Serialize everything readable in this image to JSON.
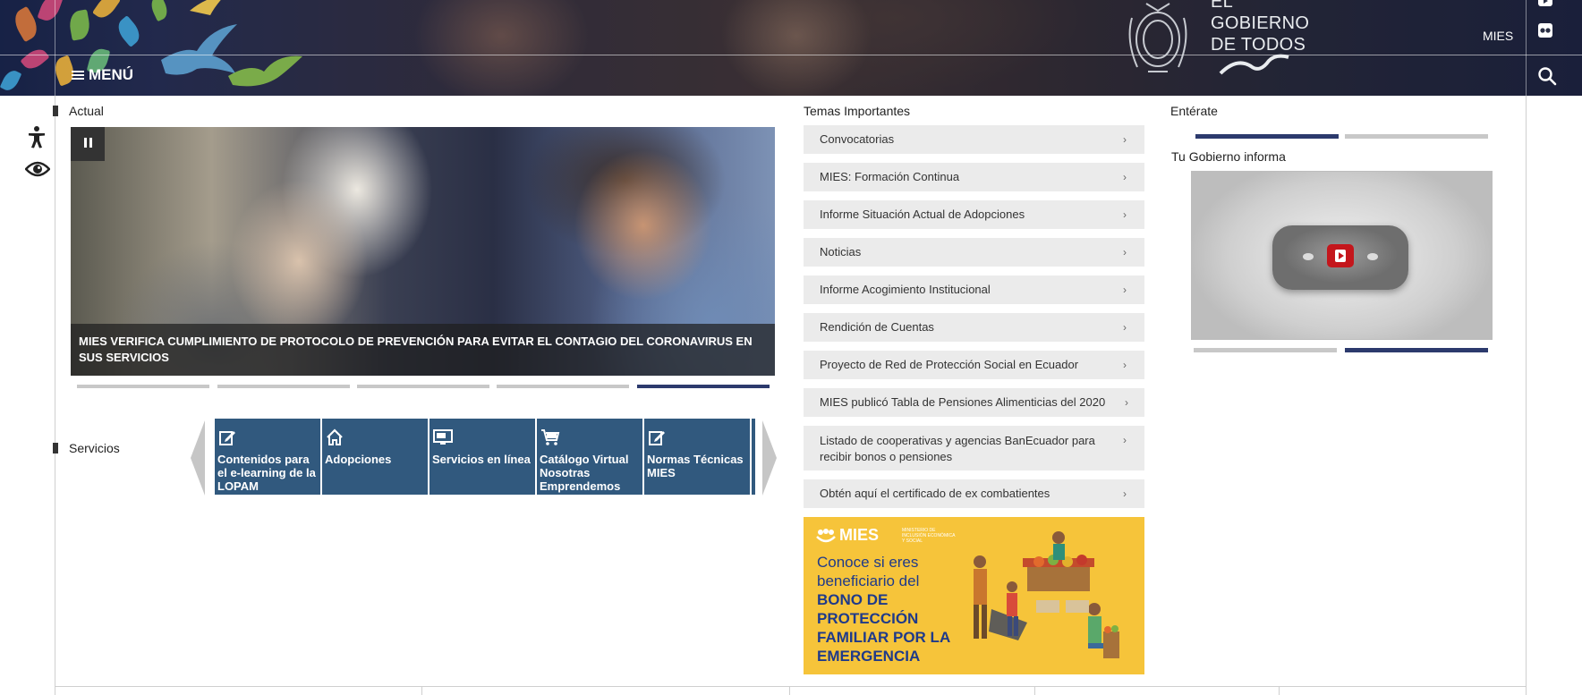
{
  "header": {
    "menu_label": "MENÚ",
    "gov_line1": "EL",
    "gov_line2": "GOBIERNO",
    "gov_line3": "DE TODOS",
    "mies_link": "MIES",
    "icons": [
      "youtube-icon",
      "flickr-icon",
      "search-icon",
      "menu-icon",
      "ecuador-seal-icon"
    ]
  },
  "accessibility": {
    "icons": [
      "accessibility-person-icon",
      "visibility-eye-icon"
    ]
  },
  "actual": {
    "title": "Actual",
    "caption": "MIES VERIFICA CUMPLIMIENTO DE PROTOCOLO DE PREVENCIÓN PARA EVITAR EL CONTAGIO DEL CORONAVIRUS EN SUS SERVICIOS",
    "slide_count": 5,
    "active_slide": 5
  },
  "servicios": {
    "title": "Servicios",
    "items": [
      {
        "label": "Contenidos para el e-learning de la LOPAM",
        "icon": "edit-icon"
      },
      {
        "label": "Adopciones",
        "icon": "home-icon"
      },
      {
        "label": "Servicios en línea",
        "icon": "monitor-icon"
      },
      {
        "label": "Catálogo Virtual Nosotras Emprendemos",
        "icon": "cart-icon"
      },
      {
        "label": "Normas Técnicas MIES",
        "icon": "edit-icon"
      }
    ]
  },
  "temas": {
    "title": "Temas Importantes",
    "items": [
      "Convocatorias",
      "MIES: Formación Continua",
      "Informe Situación Actual de Adopciones",
      "Noticias",
      "Informe Acogimiento Institucional",
      "Rendición de Cuentas",
      "Proyecto de Red de Protección Social en Ecuador",
      "MIES publicó Tabla de Pensiones Alimenticias del 2020",
      "Listado de cooperativas y agencias BanEcuador para recibir bonos o pensiones",
      "Obtén aquí el certificado de ex combatientes"
    ],
    "chevron": "›"
  },
  "banner": {
    "logo": "MIES",
    "logo_sub": "MINISTERIO DE INCLUSIÓN ECONÓMICA Y SOCIAL",
    "line1": "Conoce si eres beneficiario del",
    "line2": "BONO DE PROTECCIÓN FAMILIAR POR LA EMERGENCIA"
  },
  "enterate": {
    "title": "Entérate",
    "video_title": "Tu Gobierno informa",
    "top_active_tab": 1,
    "bottom_active_tab": 2
  },
  "colors": {
    "accent_navy": "#2c3a6d",
    "service_blue": "#31597e",
    "topic_bg": "#ebebeb",
    "banner_yellow": "#f6c43a",
    "youtube_red": "#c4161c"
  }
}
